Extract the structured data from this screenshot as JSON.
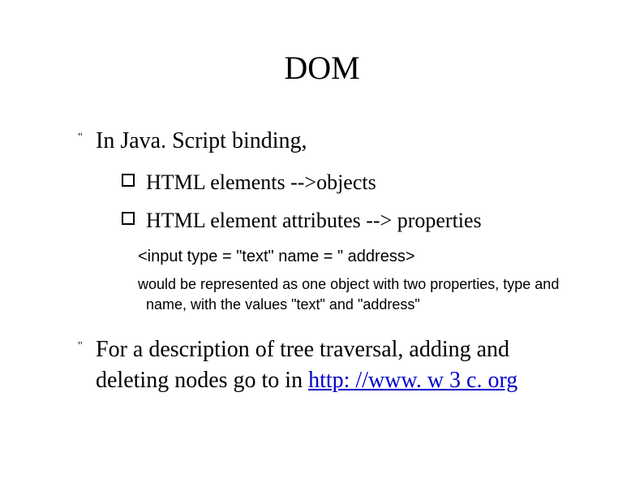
{
  "title": "DOM",
  "bullets": [
    {
      "text": "In Java. Script binding,"
    },
    {
      "text": "For a description of tree traversal, adding and deleting nodes go to in ",
      "link_text": "http: //www. w 3 c. org"
    }
  ],
  "sub_bullets": [
    {
      "text": "HTML elements -->objects"
    },
    {
      "text": "HTML element attributes --> properties"
    }
  ],
  "example": {
    "code": "<input type = \"text\" name = \" address>",
    "desc_pre": "would be represented as one object with two properties, ",
    "prop1": "type",
    "desc_mid1": " and ",
    "prop2": "name",
    "desc_mid2": ", with the values ",
    "val1": "\"text\"",
    "desc_mid3": " and ",
    "val2": "\"address\""
  }
}
